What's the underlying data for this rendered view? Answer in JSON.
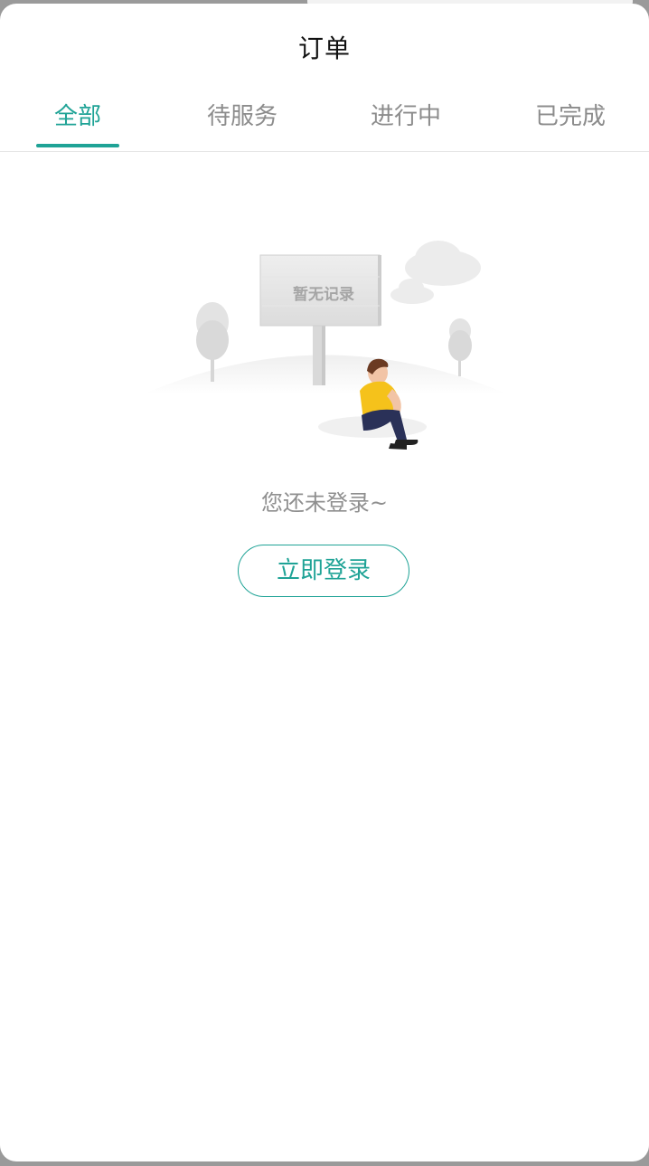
{
  "header": {
    "title": "订单"
  },
  "tabs": [
    {
      "label": "全部",
      "active": true
    },
    {
      "label": "待服务",
      "active": false
    },
    {
      "label": "进行中",
      "active": false
    },
    {
      "label": "已完成",
      "active": false
    }
  ],
  "empty_state": {
    "sign_text": "暂无记录",
    "message": "您还未登录~",
    "login_button": "立即登录"
  },
  "colors": {
    "accent": "#1fa396",
    "muted_text": "#8c8c8c",
    "shirt": "#f5c21b",
    "pants": "#2a3158"
  },
  "icons": {
    "illustration": "empty-record-illustration"
  }
}
